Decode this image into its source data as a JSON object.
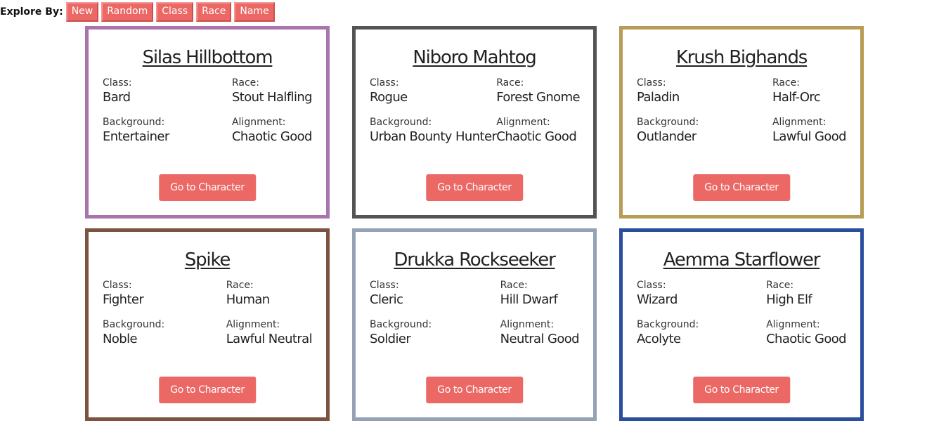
{
  "explore": {
    "label": "Explore By:",
    "buttons": [
      "New",
      "Random",
      "Class",
      "Race",
      "Name"
    ]
  },
  "labels": {
    "class": "Class:",
    "race": "Race:",
    "background": "Background:",
    "alignment": "Alignment:",
    "go": "Go to Character"
  },
  "characters": [
    {
      "name": "Silas Hillbottom",
      "class": "Bard",
      "race": "Stout Halfling",
      "background": "Entertainer",
      "alignment": "Chaotic Good",
      "border_color": "#a974ad"
    },
    {
      "name": "Niboro Mahtog",
      "class": "Rogue",
      "race": "Forest Gnome",
      "background": "Urban Bounty Hunter",
      "alignment": "Chaotic Good",
      "border_color": "#545454"
    },
    {
      "name": "Krush Bighands",
      "class": "Paladin",
      "race": "Half-Orc",
      "background": "Outlander",
      "alignment": "Lawful Good",
      "border_color": "#b89c55"
    },
    {
      "name": "Spike",
      "class": "Fighter",
      "race": "Human",
      "background": "Noble",
      "alignment": "Lawful Neutral",
      "border_color": "#7c5240"
    },
    {
      "name": "Drukka Rockseeker",
      "class": "Cleric",
      "race": "Hill Dwarf",
      "background": "Soldier",
      "alignment": "Neutral Good",
      "border_color": "#94a3b3"
    },
    {
      "name": "Aemma Starflower",
      "class": "Wizard",
      "race": "High Elf",
      "background": "Acolyte",
      "alignment": "Chaotic Good",
      "border_color": "#2a4d9c"
    }
  ]
}
